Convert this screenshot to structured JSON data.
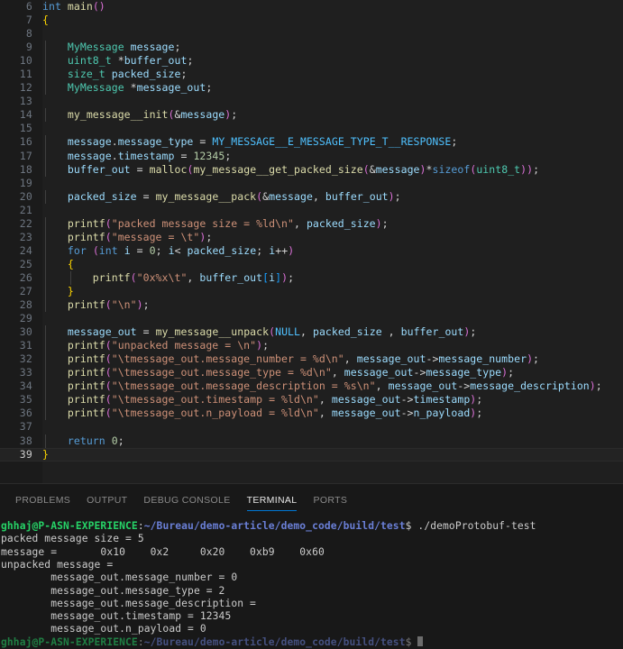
{
  "editor": {
    "first_line_number": 6,
    "active_line": 39,
    "background": "#1f1f1f",
    "gutter_background": "#1b1b1b",
    "lines": [
      {
        "n": 6,
        "indent": 0,
        "guides": [],
        "text": "int main()"
      },
      {
        "n": 7,
        "indent": 0,
        "guides": [],
        "text": "{"
      },
      {
        "n": 8,
        "indent": 0,
        "guides": [
          1
        ],
        "text": ""
      },
      {
        "n": 9,
        "indent": 1,
        "guides": [
          1
        ],
        "text": "MyMessage message;"
      },
      {
        "n": 10,
        "indent": 1,
        "guides": [
          1
        ],
        "text": "uint8_t *buffer_out;"
      },
      {
        "n": 11,
        "indent": 1,
        "guides": [
          1
        ],
        "text": "size_t packed_size;"
      },
      {
        "n": 12,
        "indent": 1,
        "guides": [
          1
        ],
        "text": "MyMessage *message_out;"
      },
      {
        "n": 13,
        "indent": 0,
        "guides": [
          1
        ],
        "text": ""
      },
      {
        "n": 14,
        "indent": 1,
        "guides": [
          1
        ],
        "text": "my_message__init(&message);"
      },
      {
        "n": 15,
        "indent": 0,
        "guides": [
          1
        ],
        "text": ""
      },
      {
        "n": 16,
        "indent": 1,
        "guides": [
          1
        ],
        "text": "message.message_type = MY_MESSAGE__E_MESSAGE_TYPE_T__RESPONSE;"
      },
      {
        "n": 17,
        "indent": 1,
        "guides": [
          1
        ],
        "text": "message.timestamp = 12345;"
      },
      {
        "n": 18,
        "indent": 1,
        "guides": [
          1
        ],
        "text": "buffer_out = malloc(my_message__get_packed_size(&message)*sizeof(uint8_t));"
      },
      {
        "n": 19,
        "indent": 0,
        "guides": [
          1
        ],
        "text": ""
      },
      {
        "n": 20,
        "indent": 1,
        "guides": [
          1
        ],
        "text": "packed_size = my_message__pack(&message, buffer_out);"
      },
      {
        "n": 21,
        "indent": 0,
        "guides": [
          1
        ],
        "text": ""
      },
      {
        "n": 22,
        "indent": 1,
        "guides": [
          1
        ],
        "text": "printf(\"packed message size = %ld\\n\", packed_size);"
      },
      {
        "n": 23,
        "indent": 1,
        "guides": [
          1
        ],
        "text": "printf(\"message = \\t\");"
      },
      {
        "n": 24,
        "indent": 1,
        "guides": [
          1
        ],
        "text": "for (int i = 0; i< packed_size; i++)"
      },
      {
        "n": 25,
        "indent": 1,
        "guides": [
          1
        ],
        "text": "{"
      },
      {
        "n": 26,
        "indent": 2,
        "guides": [
          1,
          2
        ],
        "text": "printf(\"0x%x\\t\", buffer_out[i]);"
      },
      {
        "n": 27,
        "indent": 1,
        "guides": [
          1
        ],
        "text": "}"
      },
      {
        "n": 28,
        "indent": 1,
        "guides": [
          1
        ],
        "text": "printf(\"\\n\");"
      },
      {
        "n": 29,
        "indent": 0,
        "guides": [
          1
        ],
        "text": ""
      },
      {
        "n": 30,
        "indent": 1,
        "guides": [
          1
        ],
        "text": "message_out = my_message__unpack(NULL, packed_size , buffer_out);"
      },
      {
        "n": 31,
        "indent": 1,
        "guides": [
          1
        ],
        "text": "printf(\"unpacked message = \\n\");"
      },
      {
        "n": 32,
        "indent": 1,
        "guides": [
          1
        ],
        "text": "printf(\"\\tmessage_out.message_number = %d\\n\", message_out->message_number);"
      },
      {
        "n": 33,
        "indent": 1,
        "guides": [
          1
        ],
        "text": "printf(\"\\tmessage_out.message_type = %d\\n\", message_out->message_type);"
      },
      {
        "n": 34,
        "indent": 1,
        "guides": [
          1
        ],
        "text": "printf(\"\\tmessage_out.message_description = %s\\n\", message_out->message_description);"
      },
      {
        "n": 35,
        "indent": 1,
        "guides": [
          1
        ],
        "text": "printf(\"\\tmessage_out.timestamp = %ld\\n\", message_out->timestamp);"
      },
      {
        "n": 36,
        "indent": 1,
        "guides": [
          1
        ],
        "text": "printf(\"\\tmessage_out.n_payload = %ld\\n\", message_out->n_payload);"
      },
      {
        "n": 37,
        "indent": 0,
        "guides": [
          1
        ],
        "text": ""
      },
      {
        "n": 38,
        "indent": 1,
        "guides": [
          1
        ],
        "text": "return 0;"
      },
      {
        "n": 39,
        "indent": 0,
        "guides": [],
        "text": "}"
      }
    ]
  },
  "panel": {
    "tabs": [
      {
        "id": "problems",
        "label": "PROBLEMS",
        "active": false
      },
      {
        "id": "output",
        "label": "OUTPUT",
        "active": false
      },
      {
        "id": "debug-console",
        "label": "DEBUG CONSOLE",
        "active": false
      },
      {
        "id": "terminal",
        "label": "TERMINAL",
        "active": true
      },
      {
        "id": "ports",
        "label": "PORTS",
        "active": false
      }
    ],
    "active_tab": "TERMINAL",
    "accent_color": "#0078d4"
  },
  "terminal": {
    "prompt": {
      "user_host": "ghhaj@P-ASN-EXPERIENCE",
      "separator": ":",
      "path": "~/Bureau/demo-article/demo_code/build/test",
      "sigil": "$",
      "command": "./demoProtobuf-test"
    },
    "output": [
      "packed message size = 5",
      "message = \t0x10\t0x2\t0x20\t0xb9\t0x60",
      "unpacked message = ",
      "        message_out.message_number = 0",
      "        message_out.message_type = 2",
      "        message_out.message_description = ",
      "        message_out.timestamp = 12345",
      "        message_out.n_payload = 0"
    ],
    "next_prompt": {
      "user_host": "ghhaj@P-ASN-EXPERIENCE",
      "separator": ":",
      "path": "~/Bureau/demo-article/demo_code/build/test",
      "sigil": "$"
    },
    "colors": {
      "user_host": "#26d367",
      "path": "#6a7fd6",
      "text": "#cccccc",
      "background": "#181818"
    }
  }
}
